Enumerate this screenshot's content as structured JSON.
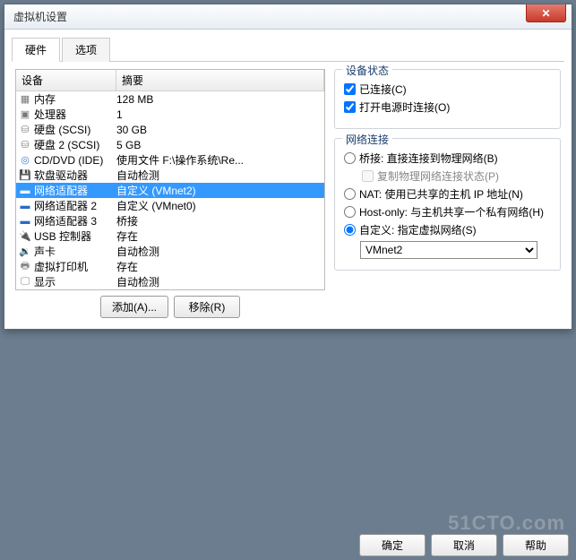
{
  "title": "虚拟机设置",
  "tabs": {
    "hardware": "硬件",
    "options": "选项"
  },
  "list": {
    "header_device": "设备",
    "header_summary": "摘要",
    "rows": [
      {
        "icon": "▦",
        "cls": "ic-chip",
        "device": "内存",
        "summary": "128 MB"
      },
      {
        "icon": "▣",
        "cls": "ic-cpu",
        "device": "处理器",
        "summary": "1"
      },
      {
        "icon": "⛁",
        "cls": "ic-hdd",
        "device": "硬盘 (SCSI)",
        "summary": "30 GB"
      },
      {
        "icon": "⛁",
        "cls": "ic-hdd",
        "device": "硬盘 2 (SCSI)",
        "summary": "5 GB"
      },
      {
        "icon": "◎",
        "cls": "ic-cd",
        "device": "CD/DVD (IDE)",
        "summary": "使用文件 F:\\操作系统\\Re..."
      },
      {
        "icon": "💾",
        "cls": "ic-fd",
        "device": "软盘驱动器",
        "summary": "自动检测"
      },
      {
        "icon": "▬",
        "cls": "ic-nic",
        "device": "网络适配器",
        "summary": "自定义 (VMnet2)",
        "selected": true
      },
      {
        "icon": "▬",
        "cls": "ic-nic",
        "device": "网络适配器 2",
        "summary": "自定义 (VMnet0)"
      },
      {
        "icon": "▬",
        "cls": "ic-nic",
        "device": "网络适配器 3",
        "summary": "桥接"
      },
      {
        "icon": "🔌",
        "cls": "ic-usb",
        "device": "USB 控制器",
        "summary": "存在"
      },
      {
        "icon": "🔉",
        "cls": "ic-snd",
        "device": "声卡",
        "summary": "自动检测"
      },
      {
        "icon": "🖶",
        "cls": "ic-prn",
        "device": "虚拟打印机",
        "summary": "存在"
      },
      {
        "icon": "🖵",
        "cls": "ic-dsp",
        "device": "显示",
        "summary": "自动检测"
      }
    ]
  },
  "buttons": {
    "add": "添加(A)...",
    "remove": "移除(R)"
  },
  "status": {
    "title": "设备状态",
    "connected": "已连接(C)",
    "connect_power": "打开电源时连接(O)"
  },
  "network": {
    "title": "网络连接",
    "bridged": "桥接: 直接连接到物理网络(B)",
    "replicate": "复制物理网络连接状态(P)",
    "nat": "NAT: 使用已共享的主机 IP 地址(N)",
    "hostonly": "Host-only: 与主机共享一个私有网络(H)",
    "custom": "自定义: 指定虚拟网络(S)",
    "selected_vnet": "VMnet2"
  },
  "dialog_buttons": {
    "ok": "确定",
    "cancel": "取消",
    "help": "帮助"
  }
}
